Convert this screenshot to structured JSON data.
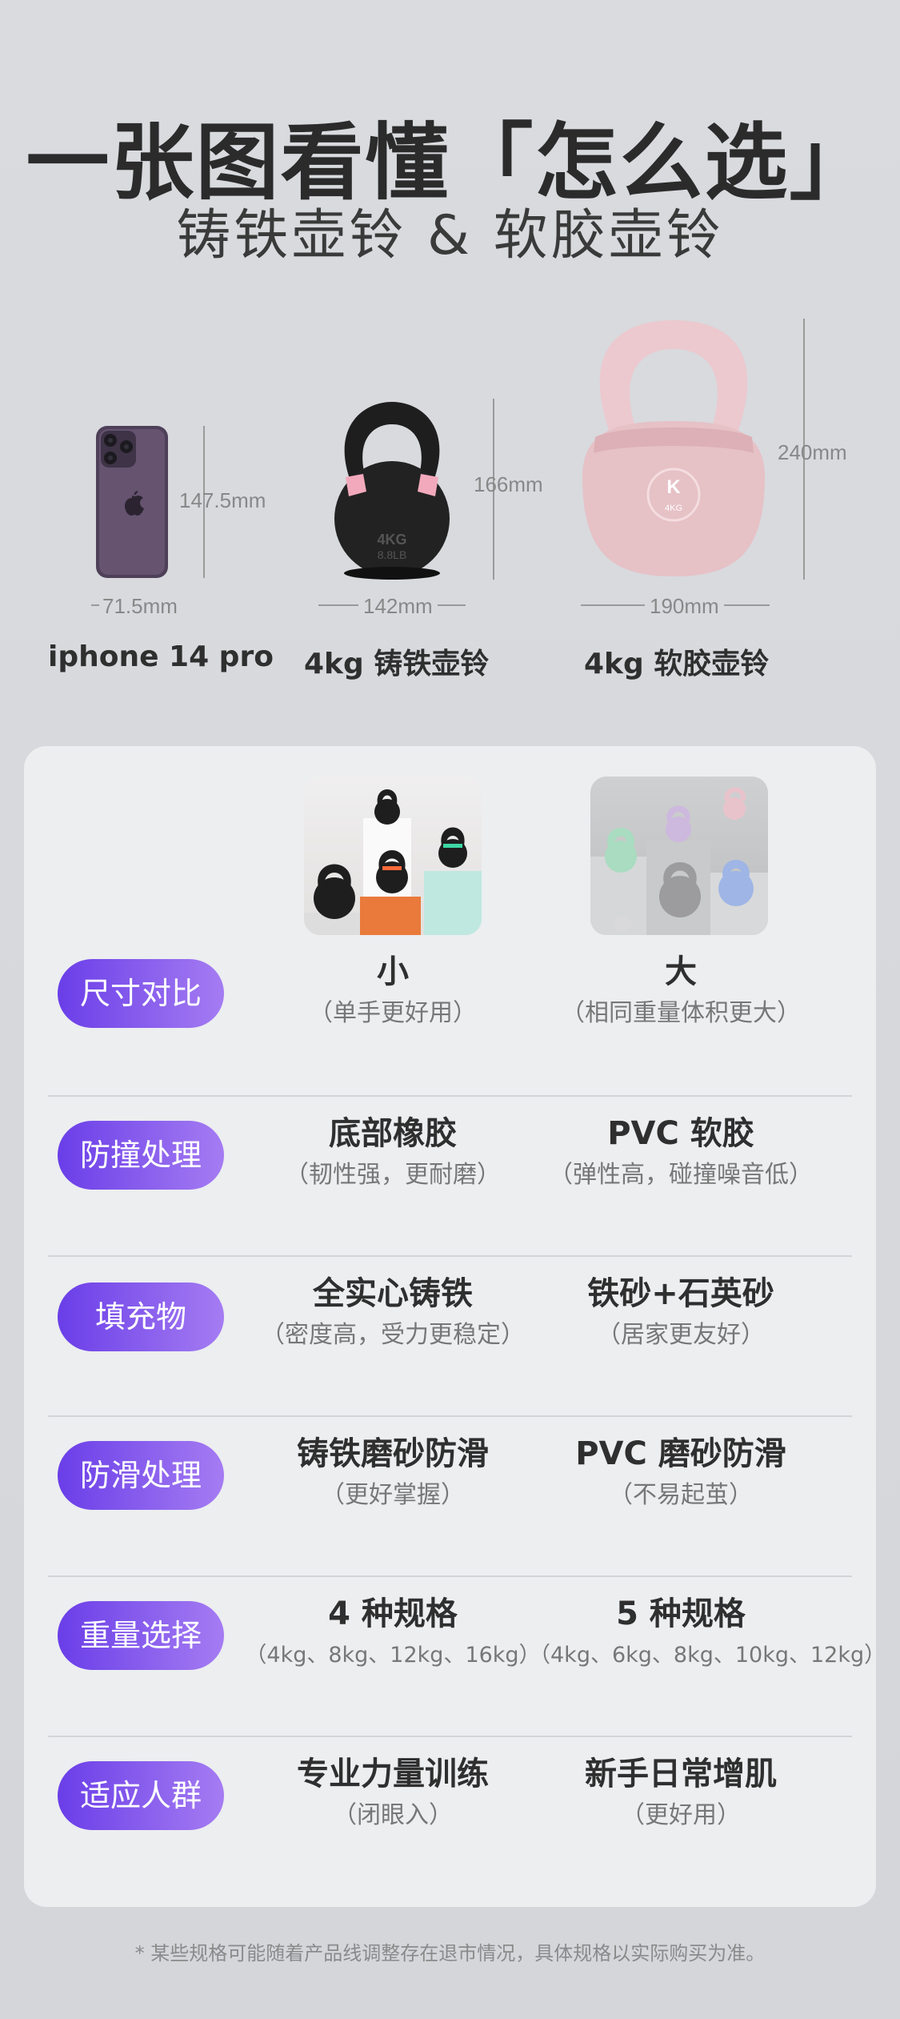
{
  "header": {
    "title": "一张图看懂「怎么选」",
    "subtitle": "铸铁壶铃 & 软胶壶铃"
  },
  "products": [
    {
      "name": "iphone 14 pro",
      "width_label": "71.5mm",
      "height_label": "147.5mm"
    },
    {
      "name": "4kg 铸铁壶铃",
      "width_label": "142mm",
      "height_label": "166mm",
      "weight_mark": "4KG",
      "lb_mark": "8.8LB"
    },
    {
      "name": "4kg 软胶壶铃",
      "width_label": "190mm",
      "height_label": "240mm",
      "weight_mark": "4KG",
      "logo": "K"
    }
  ],
  "comparison": {
    "rows": [
      {
        "label": "尺寸对比",
        "left_main": "小",
        "left_sub": "（单手更好用）",
        "right_main": "大",
        "right_sub": "（相同重量体积更大）"
      },
      {
        "label": "防撞处理",
        "left_main": "底部橡胶",
        "left_sub": "（韧性强，更耐磨）",
        "right_main": "PVC 软胶",
        "right_sub": "（弹性高，碰撞噪音低）"
      },
      {
        "label": "填充物",
        "left_main": "全实心铸铁",
        "left_sub": "（密度高，受力更稳定）",
        "right_main": "铁砂+石英砂",
        "right_sub": "（居家更友好）"
      },
      {
        "label": "防滑处理",
        "left_main": "铸铁磨砂防滑",
        "left_sub": "（更好掌握）",
        "right_main": "PVC 磨砂防滑",
        "right_sub": "（不易起茧）"
      },
      {
        "label": "重量选择",
        "left_main": "4 种规格",
        "left_sub": "（4kg、8kg、12kg、16kg）",
        "right_main": "5 种规格",
        "right_sub": "（4kg、6kg、8kg、10kg、12kg）"
      },
      {
        "label": "适应人群",
        "left_main": "专业力量训练",
        "left_sub": "（闭眼入）",
        "right_main": "新手日常增肌",
        "right_sub": "（更好用）"
      }
    ]
  },
  "footnote": "* 某些规格可能随着产品线调整存在退市情况，具体规格以实际购买为准。",
  "colors": {
    "accent_start": "#6a3ee8",
    "accent_end": "#a57cf2",
    "soft_kettlebell": "#e8c6cb",
    "cast_kettlebell": "#1d1d1d",
    "iphone": "#5a4a63"
  }
}
